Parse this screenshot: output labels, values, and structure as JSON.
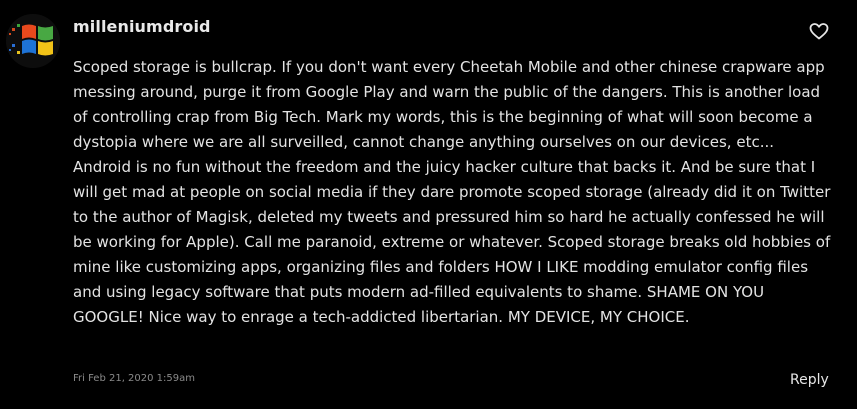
{
  "comment": {
    "username": "milleniumdroid",
    "body": "Scoped storage is bullcrap. If you don't want every Cheetah Mobile and other chinese crapware app messing around, purge it from Google Play and warn the public of the dangers. This is another load of controlling crap from Big Tech. Mark my words, this is the beginning of what will soon become a dystopia where we are all surveilled, cannot change anything ourselves on our devices, etc... Android is no fun without the freedom and the juicy hacker culture that backs it. And be sure that I will get mad at people on social media if they dare promote scoped storage (already did it on Twitter to the author of Magisk, deleted my tweets and pressured him so hard he actually confessed he will be working for Apple). Call me paranoid, extreme or whatever. Scoped storage breaks old hobbies of mine like customizing apps, organizing files and folders HOW I LIKE modding emulator config files and using legacy software that puts modern ad-filled equivalents to shame. SHAME ON YOU GOOGLE! Nice way to enrage a tech-addicted libertarian. MY DEVICE, MY CHOICE.",
    "timestamp": "Fri Feb 21, 2020 1:59am",
    "reply_label": "Reply"
  },
  "icons": {
    "avatar": "windows-logo-avatar",
    "like": "heart-icon"
  },
  "colors": {
    "background": "#000000",
    "text": "#e3e3e3",
    "timestamp": "#8a8a8a"
  }
}
